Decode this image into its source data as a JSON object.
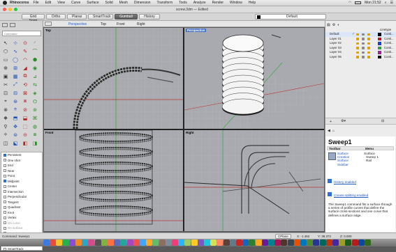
{
  "menubar": {
    "app": "Rhinoceros",
    "items": [
      "File",
      "Edit",
      "View",
      "Curve",
      "Surface",
      "Solid",
      "Mesh",
      "Dimension",
      "Transform",
      "Tools",
      "Analyze",
      "Render",
      "Window",
      "Help"
    ],
    "clock": "Mon 21:52"
  },
  "window": {
    "title": "screw.3dm — Edited"
  },
  "toolbar": {
    "buttons": [
      "Grid Snap",
      "Ortho",
      "Planar",
      "SmartTrack",
      "Gumball",
      "History"
    ],
    "active": "Gumball",
    "layer_current": "Default"
  },
  "command": {
    "placeholder": "Command",
    "last": "Command: Sweep1"
  },
  "osnaps": [
    {
      "label": "Persistent",
      "on": true,
      "enabled": true
    },
    {
      "label": "One shot",
      "on": false,
      "enabled": true
    },
    {
      "label": "End",
      "on": false,
      "enabled": true
    },
    {
      "label": "Near",
      "on": false,
      "enabled": true
    },
    {
      "label": "Point",
      "on": false,
      "enabled": true
    },
    {
      "label": "Midpoint",
      "on": true,
      "enabled": true
    },
    {
      "label": "Center",
      "on": false,
      "enabled": true
    },
    {
      "label": "Intersection",
      "on": false,
      "enabled": true
    },
    {
      "label": "Perpendicular",
      "on": false,
      "enabled": true
    },
    {
      "label": "Tangent",
      "on": false,
      "enabled": true
    },
    {
      "label": "Quadrant",
      "on": false,
      "enabled": true
    },
    {
      "label": "Knot",
      "on": false,
      "enabled": true
    },
    {
      "label": "Vertex",
      "on": false,
      "enabled": true
    },
    {
      "label": "On curve",
      "on": false,
      "enabled": false
    },
    {
      "label": "On surface",
      "on": false,
      "enabled": false
    },
    {
      "label": "On polysurface",
      "on": false,
      "enabled": false
    },
    {
      "label": "On mesh",
      "on": false,
      "enabled": false
    },
    {
      "label": "Project",
      "on": false,
      "enabled": true
    },
    {
      "label": "SmartTrack",
      "on": false,
      "enabled": true
    }
  ],
  "viewport_tabs": [
    "Perspective",
    "Top",
    "Front",
    "Right"
  ],
  "viewports": {
    "top": "Top",
    "perspective": "Perspective",
    "front": "Front",
    "right": "Right"
  },
  "layers": {
    "header_linetype": "Linetype",
    "rows": [
      {
        "name": "Default",
        "color": "#000000",
        "linetype": "Conti..."
      },
      {
        "name": "Layer 01",
        "color": "#c8102e",
        "linetype": "Conti..."
      },
      {
        "name": "Layer 02",
        "color": "#1a3fd6",
        "linetype": "Conti..."
      },
      {
        "name": "Layer 03",
        "color": "#2ea043",
        "linetype": "Conti..."
      },
      {
        "name": "Layer 04",
        "color": "#a31fa3",
        "linetype": "Conti..."
      },
      {
        "name": "Layer 05",
        "color": "#000000",
        "linetype": "Conti..."
      }
    ]
  },
  "help": {
    "title": "Sweep1",
    "toolbar_header": "Toolbar",
    "menu_header": "Menu",
    "toolbar_path": [
      "Surface",
      "Creation",
      "Surface",
      "Sidebar"
    ],
    "menu_path": [
      "Surface",
      "Sweep 1",
      "Rail"
    ],
    "history": "History enabled",
    "splitting": "Crease splitting enabled",
    "description": "The Sweep1 command fits a surface through a series of profile curves that define the surface cross-sections and one curve that defines a surface edge."
  },
  "status": {
    "cplane": "CPlane",
    "x": "X: -1.462",
    "y": "Y: 38.372",
    "z": "Z: 0.000"
  },
  "colors": {
    "accent": "#4a76c8",
    "viewport_bg": "#a8aab0",
    "grid_x": "#b33",
    "grid_y": "#3a3"
  }
}
